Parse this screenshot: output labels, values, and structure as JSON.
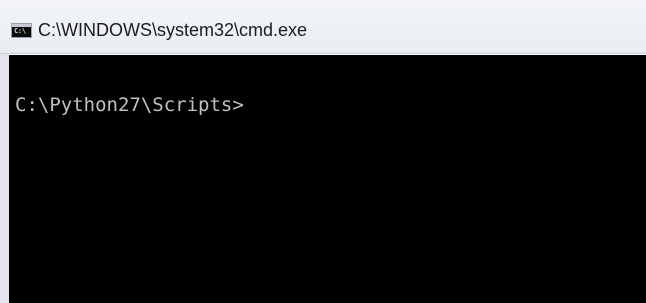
{
  "window": {
    "title": "C:\\WINDOWS\\system32\\cmd.exe",
    "icon": "cmd-console-icon",
    "icon_label": "C:\\"
  },
  "console": {
    "prompt": "C:\\Python27\\Scripts>",
    "background_color": "#000000",
    "text_color": "#c0c0c0"
  }
}
